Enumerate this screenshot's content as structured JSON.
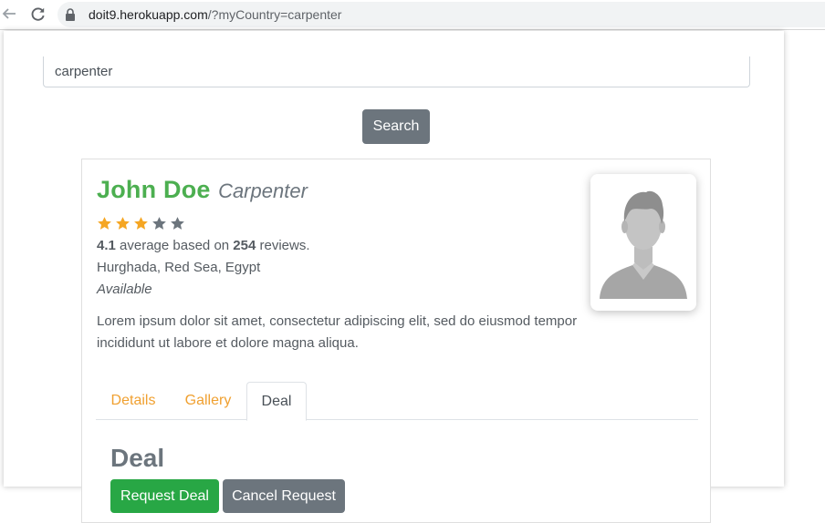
{
  "browser": {
    "url_host": "doit9.herokuapp.com",
    "url_path": "/?myCountry=carpenter"
  },
  "search": {
    "value": "carpenter",
    "button_label": "Search"
  },
  "profile": {
    "name": "John Doe",
    "profession": "Carpenter",
    "rating": {
      "filled_stars": 3,
      "total_stars": 5,
      "average": "4.1",
      "text_mid": " average based on ",
      "reviews": "254",
      "text_end": " reviews."
    },
    "location": "Hurghada, Red Sea, Egypt",
    "availability": "Available",
    "description": "Lorem ipsum dolor sit amet, consectetur adipiscing elit, sed do eiusmod tempor incididunt ut labore et dolore magna aliqua."
  },
  "tabs": [
    {
      "label": "Details",
      "active": false
    },
    {
      "label": "Gallery",
      "active": false
    },
    {
      "label": "Deal",
      "active": true
    }
  ],
  "deal": {
    "heading": "Deal",
    "request_label": "Request Deal",
    "cancel_label": "Cancel Request"
  },
  "colors": {
    "star_filled": "#f5a623",
    "star_empty": "#6c757d",
    "name": "#4caf50",
    "tab_link": "#f0a030",
    "success": "#28a745",
    "secondary": "#6c757d"
  },
  "icons": {
    "back": "arrow-left-icon",
    "reload": "reload-icon",
    "lock": "lock-icon",
    "star": "star-icon",
    "avatar": "person-silhouette-icon"
  }
}
